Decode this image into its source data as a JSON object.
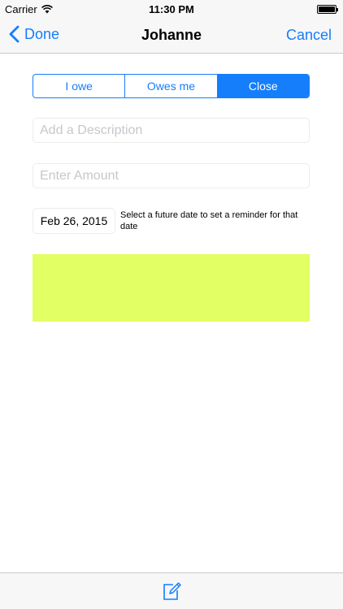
{
  "status_bar": {
    "carrier": "Carrier",
    "time": "11:30 PM",
    "wifi_icon": "wifi-icon",
    "battery_icon": "battery-icon"
  },
  "nav": {
    "back_label": "Done",
    "title": "Johanne",
    "cancel_label": "Cancel"
  },
  "segments": [
    {
      "label": "I owe",
      "selected": false
    },
    {
      "label": "Owes me",
      "selected": false
    },
    {
      "label": "Close",
      "selected": true
    }
  ],
  "form": {
    "description_placeholder": "Add a Description",
    "description_value": "",
    "amount_placeholder": "Enter Amount",
    "amount_value": "",
    "date_value": "Feb 26, 2015",
    "date_hint": "Select a future date to set a reminder for that date"
  },
  "colors": {
    "accent": "#157efb",
    "panel": "#e2ff63",
    "bar_background": "#f7f7f8"
  },
  "toolbar": {
    "compose_icon": "compose-icon"
  }
}
